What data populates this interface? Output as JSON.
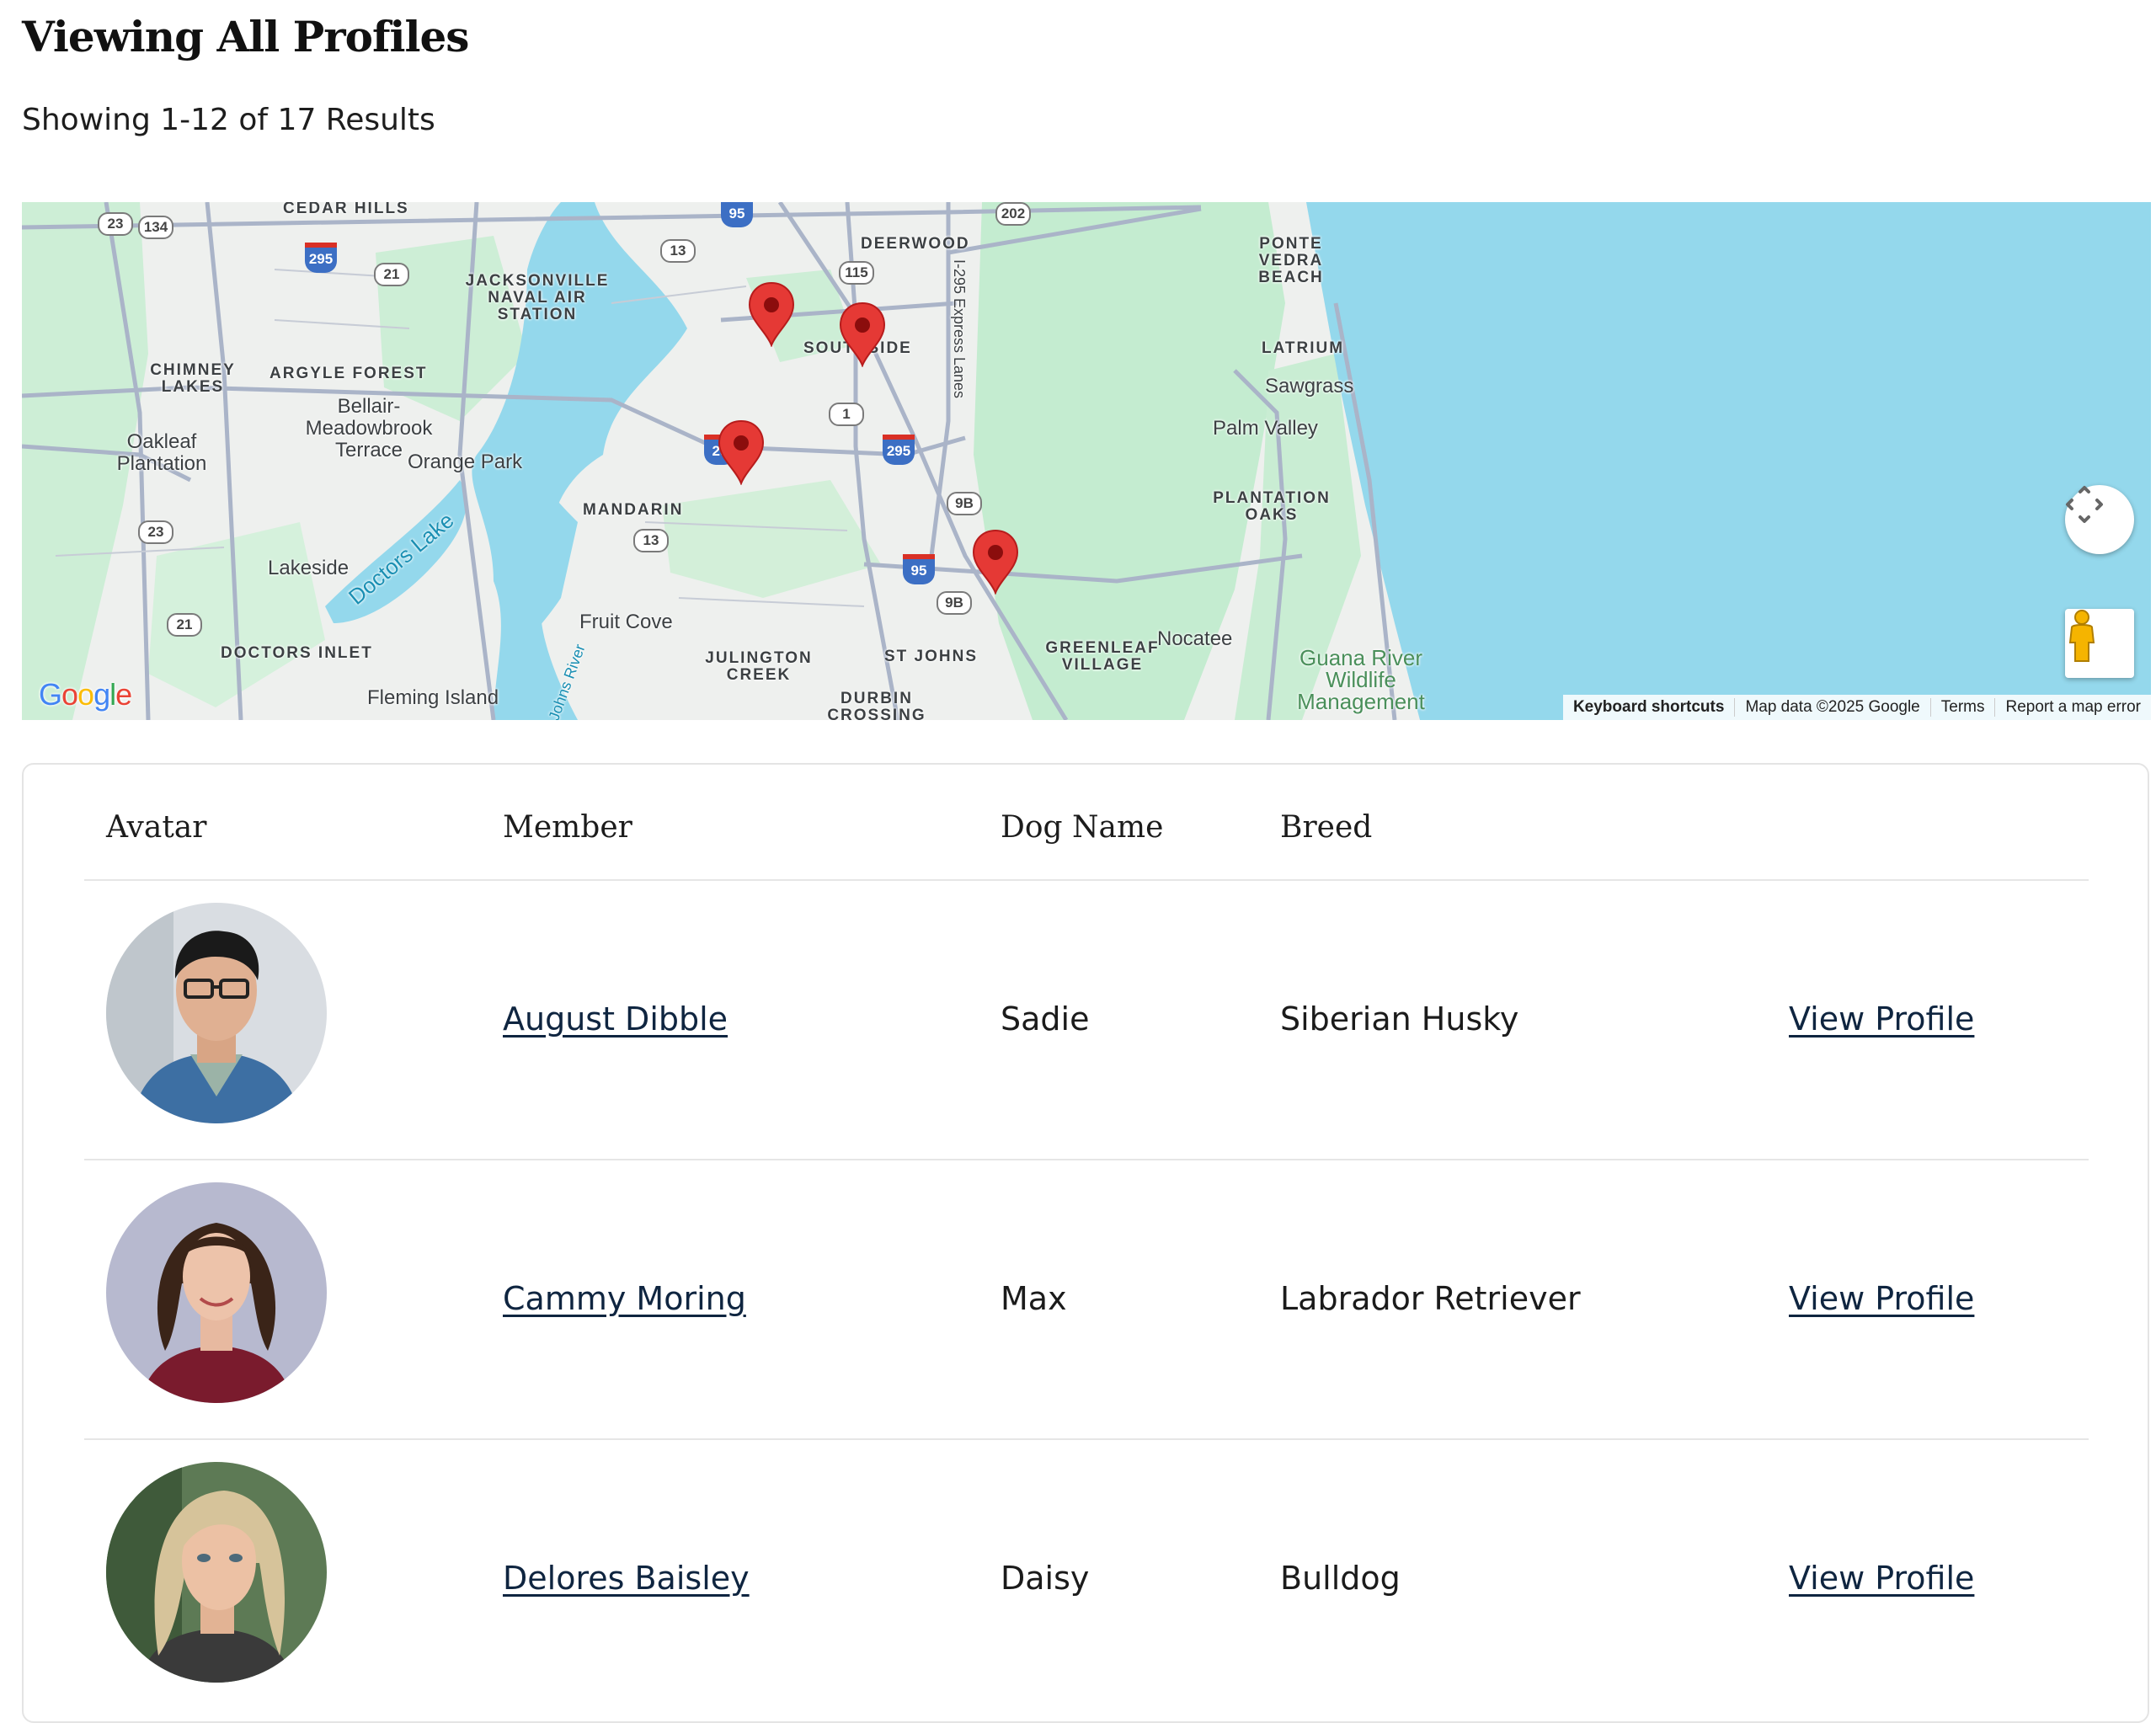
{
  "page": {
    "title": "Viewing All Profiles",
    "results_summary": "Showing 1-12 of 17 Results"
  },
  "map": {
    "place_labels": {
      "cedar_hills": "CEDAR HILLS",
      "deerwood": "DEERWOOD",
      "ponte_vedra": "PONTE VEDRA BEACH",
      "jax_naval": "JACKSONVILLE NAVAL AIR STATION",
      "chimney_lakes": "CHIMNEY LAKES",
      "argyle_forest": "ARGYLE FOREST",
      "southside": "SOUTHSIDE",
      "latrium": "LATRIUM",
      "sawgrass": "Sawgrass",
      "bellair": "Bellair-Meadowbrook Terrace",
      "oakleaf": "Oakleaf Plantation",
      "orange_park": "Orange Park",
      "palm_valley": "Palm Valley",
      "plantation_oaks": "PLANTATION OAKS",
      "mandarin": "MANDARIN",
      "doctors_lake": "Doctors Lake",
      "lakeside": "Lakeside",
      "fruit_cove": "Fruit Cove",
      "nocatee": "Nocatee",
      "doctors_inlet": "DOCTORS INLET",
      "julington_creek": "JULINGTON CREEK",
      "st_johns": "ST JOHNS",
      "greenleaf": "GREENLEAF VILLAGE",
      "guana": "Guana River Wildlife Management",
      "fleming_island": "Fleming Island",
      "durbin": "DURBIN CROSSING",
      "johns_river": "Johns River",
      "express_lanes": "I-295 Express Lanes"
    },
    "route_shields": {
      "r23a": "23",
      "r134": "134",
      "r95a": "95",
      "r202": "202",
      "r13a": "13",
      "r115": "115",
      "r295a": "295",
      "r21a": "21",
      "r1": "1",
      "r295b": "295",
      "r29": "29",
      "r9ba": "9B",
      "r23b": "23",
      "r13b": "13",
      "r95b": "95",
      "r9bb": "9B",
      "r21b": "21"
    },
    "google_logo": "Google",
    "attribution": {
      "keyboard_shortcuts": "Keyboard shortcuts",
      "map_data": "Map data ©2025 Google",
      "terms": "Terms",
      "report": "Report a map error"
    }
  },
  "table": {
    "headers": {
      "avatar": "Avatar",
      "member": "Member",
      "dog_name": "Dog Name",
      "breed": "Breed"
    },
    "rows": [
      {
        "member": "August Dibble",
        "dog_name": "Sadie",
        "breed": "Siberian Husky",
        "action": "View Profile"
      },
      {
        "member": "Cammy Moring",
        "dog_name": "Max",
        "breed": "Labrador Retriever",
        "action": "View Profile"
      },
      {
        "member": "Delores Baisley",
        "dog_name": "Daisy",
        "breed": "Bulldog",
        "action": "View Profile"
      }
    ]
  },
  "colors": {
    "link": "#0f2540",
    "marker": "#e53935",
    "water": "#94d8ec",
    "land_green": "#c4ecd0"
  }
}
